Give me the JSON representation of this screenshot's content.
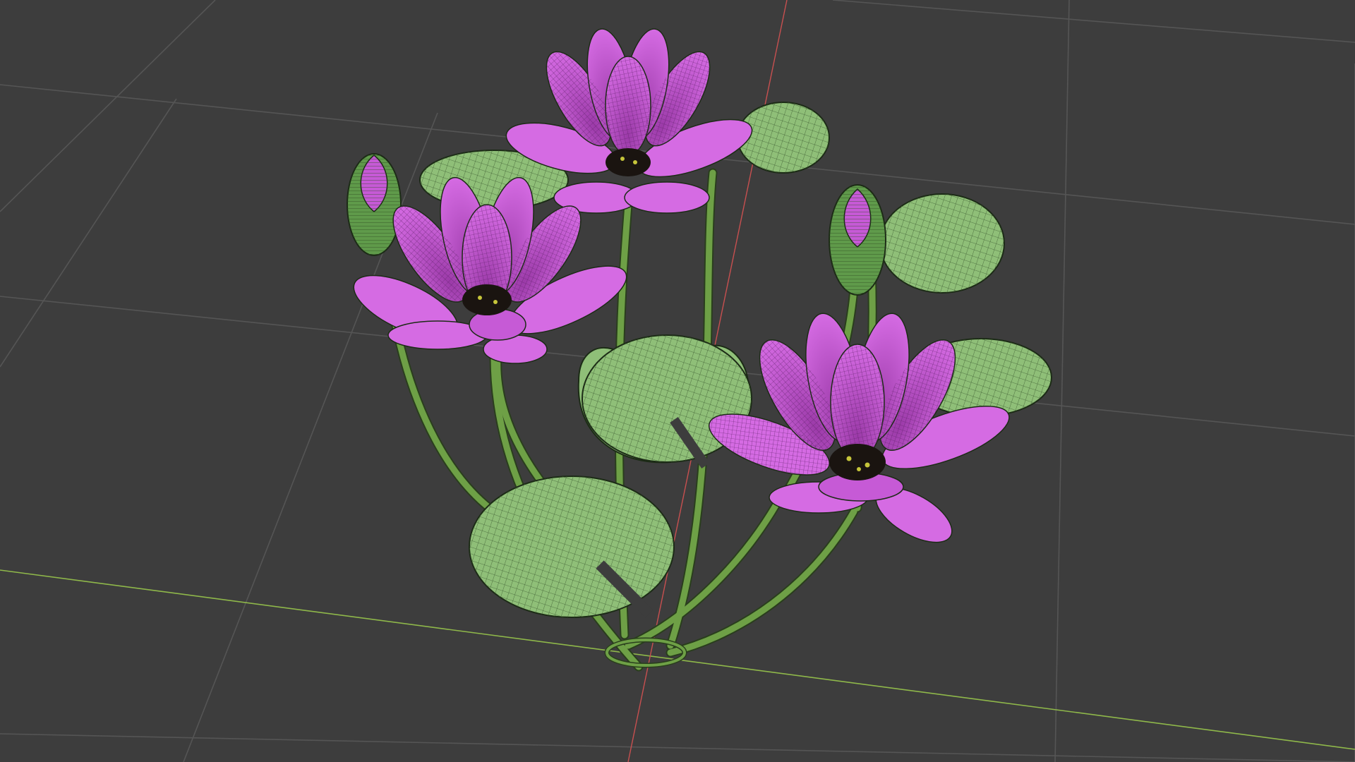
{
  "viewport": {
    "kind": "3d-viewport-wireframe-overlay",
    "background_color": "#3d3d3d",
    "grid_line_color": "#555555",
    "x_axis_color": "#8fb84a",
    "y_axis_color": "#c85050"
  },
  "scene": {
    "subject": "water-lily-model",
    "petal_color": "#c65ad6",
    "petal_dark_color": "#9b3aa8",
    "leaf_color": "#8fbf78",
    "stem_color": "#6ea046",
    "bud_green_color": "#5f9a4a",
    "flower_center_color": "#1a1410",
    "stamen_color": "#c6c53a",
    "open_flowers": 3,
    "buds": 2,
    "lily_pads": 6
  }
}
